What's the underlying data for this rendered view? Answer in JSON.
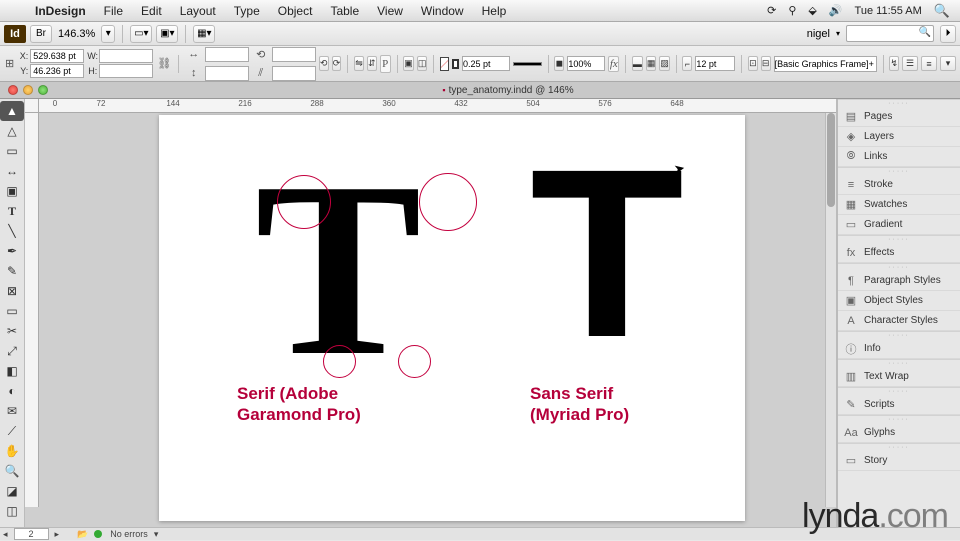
{
  "menubar": {
    "app_name": "InDesign",
    "items": [
      "File",
      "Edit",
      "Layout",
      "Type",
      "Object",
      "Table",
      "View",
      "Window",
      "Help"
    ],
    "clock": "Tue 11:55 AM"
  },
  "toolbar1": {
    "zoom": "146.3%",
    "user": "nigel",
    "search_placeholder": ""
  },
  "control_bar": {
    "x": "529.638 pt",
    "y": "46.236 pt",
    "stroke_weight": "0.25 pt",
    "opacity": "100%",
    "corner_size": "12 pt",
    "style": "[Basic Graphics Frame]+"
  },
  "document": {
    "tab_title": "type_anatomy.indd @ 146%",
    "ruler_ticks": [
      "0",
      "72",
      "144",
      "216",
      "288",
      "360",
      "432",
      "504",
      "576",
      "648"
    ],
    "serif_caption_l1": "Serif (Adobe",
    "serif_caption_l2": "Garamond Pro)",
    "sans_caption_l1": "Sans Serif",
    "sans_caption_l2": "(Myriad Pro)",
    "serif_glyph": "T",
    "sans_glyph": "T"
  },
  "panels": [
    "Pages",
    "Layers",
    "Links",
    "Stroke",
    "Swatches",
    "Gradient",
    "Effects",
    "Paragraph Styles",
    "Object Styles",
    "Character Styles",
    "Info",
    "Text Wrap",
    "Scripts",
    "Glyphs",
    "Story"
  ],
  "panel_icons": [
    "▤",
    "◈",
    "⦾",
    "≡",
    "▦",
    "▭",
    "fx",
    "¶",
    "▣",
    "A",
    "ⓘ",
    "▥",
    "✎",
    "Aa",
    "▭"
  ],
  "panel_groups": [
    3,
    3,
    1,
    3,
    1,
    1,
    1,
    1,
    1
  ],
  "status": {
    "page": "2",
    "errors": "No errors"
  },
  "watermark": {
    "brand": "lynda",
    "tld": ".com"
  }
}
